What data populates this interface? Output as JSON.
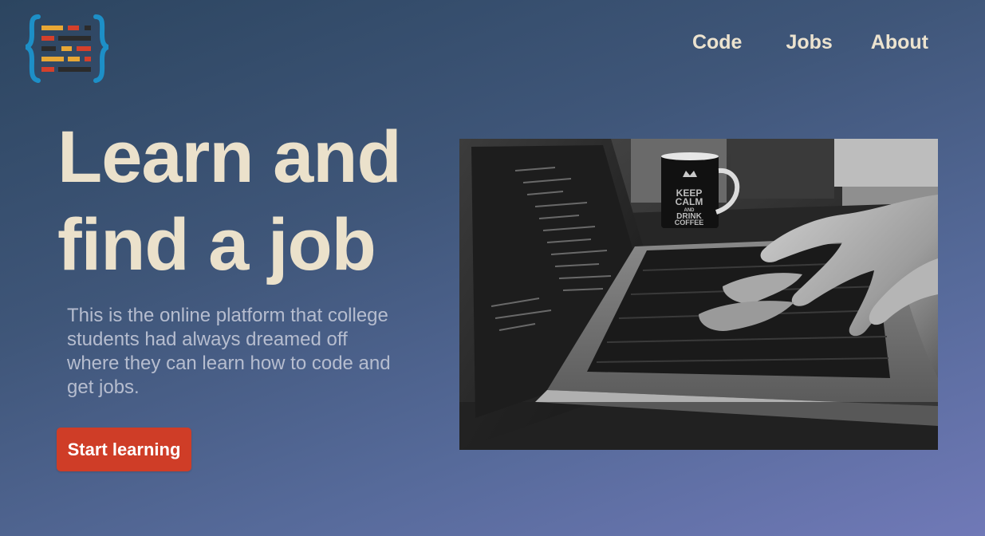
{
  "brand": {
    "logo_icon": "code-braces-logo-icon",
    "colors": {
      "brace": "#1d8fc7",
      "yellow": "#e8a735",
      "red": "#d4402b",
      "dark": "#2b2b2b"
    }
  },
  "nav": {
    "items": [
      {
        "label": "Code"
      },
      {
        "label": "Jobs"
      },
      {
        "label": "About"
      }
    ]
  },
  "hero": {
    "title_line1": "Learn and",
    "title_line2": "find a job",
    "description": "This is the online platform that college students  had always dreamed off where they can learn how to code and get jobs.",
    "cta_label": "Start learning",
    "image": {
      "subject": "laptop-typing-with-coffee-mug-photo",
      "mug_text": [
        "KEEP",
        "CALM",
        "AND",
        "DRINK",
        "COFFEE"
      ]
    }
  },
  "theme": {
    "title_color": "#ebe1cb",
    "cta_color": "#cf3d27",
    "gradient_start": "#2c4560",
    "gradient_end": "#7079b7"
  }
}
